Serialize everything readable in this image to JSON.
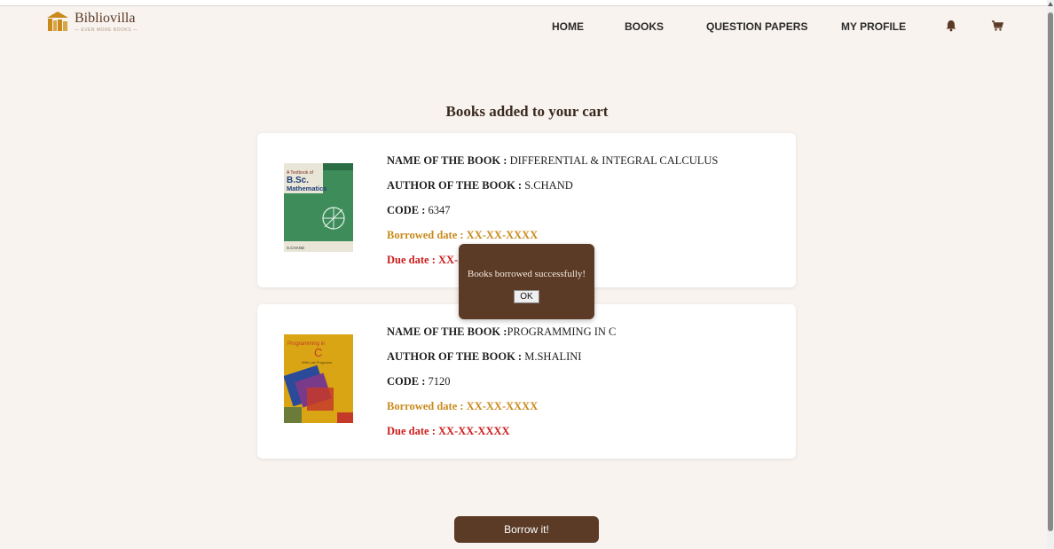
{
  "brand": {
    "name": "Bibliovilla",
    "tagline": "— EVEN MORE BOOKS —"
  },
  "nav": {
    "home": "HOME",
    "books": "BOOKS",
    "question_papers": "QUESTION PAPERS",
    "my_profile": "MY PROFILE",
    "icons": [
      "bell-icon",
      "cart-icon"
    ]
  },
  "page": {
    "title": "Books added to your cart"
  },
  "labels": {
    "name": "NAME OF THE BOOK :",
    "author": "AUTHOR OF THE BOOK :",
    "code": "CODE :"
  },
  "books": [
    {
      "name": " DIFFERENTIAL & INTEGRAL CALCULUS",
      "author": " S.CHAND",
      "code": " 6347",
      "borrowed": "Borrowed date : XX-XX-XXXX",
      "due": "Due date : XX-XX-XXXX",
      "cover": {
        "line1": "A Textbook of",
        "line2": "B.Sc.",
        "line3": "Mathematics",
        "publisher": "S.CHAND",
        "color": "#3d8c5a"
      }
    },
    {
      "name": "PROGRAMMING IN C",
      "author": " M.SHALINI",
      "code": " 7120",
      "borrowed": "Borrowed date : XX-XX-XXXX",
      "due": "Due date : XX-XX-XXXX",
      "cover": {
        "line1": "Programming in",
        "line2": "C",
        "line3": "With Lab Programs",
        "color": "#d9a514"
      }
    }
  ],
  "modal": {
    "message": "Books borrowed successfully!",
    "ok_label": "OK"
  },
  "actions": {
    "borrow_label": "Borrow it!"
  },
  "colors": {
    "background": "#f8f3ef",
    "brand_brown": "#5b3a26",
    "borrowed": "#c98a1b",
    "due": "#cc1c1c"
  }
}
